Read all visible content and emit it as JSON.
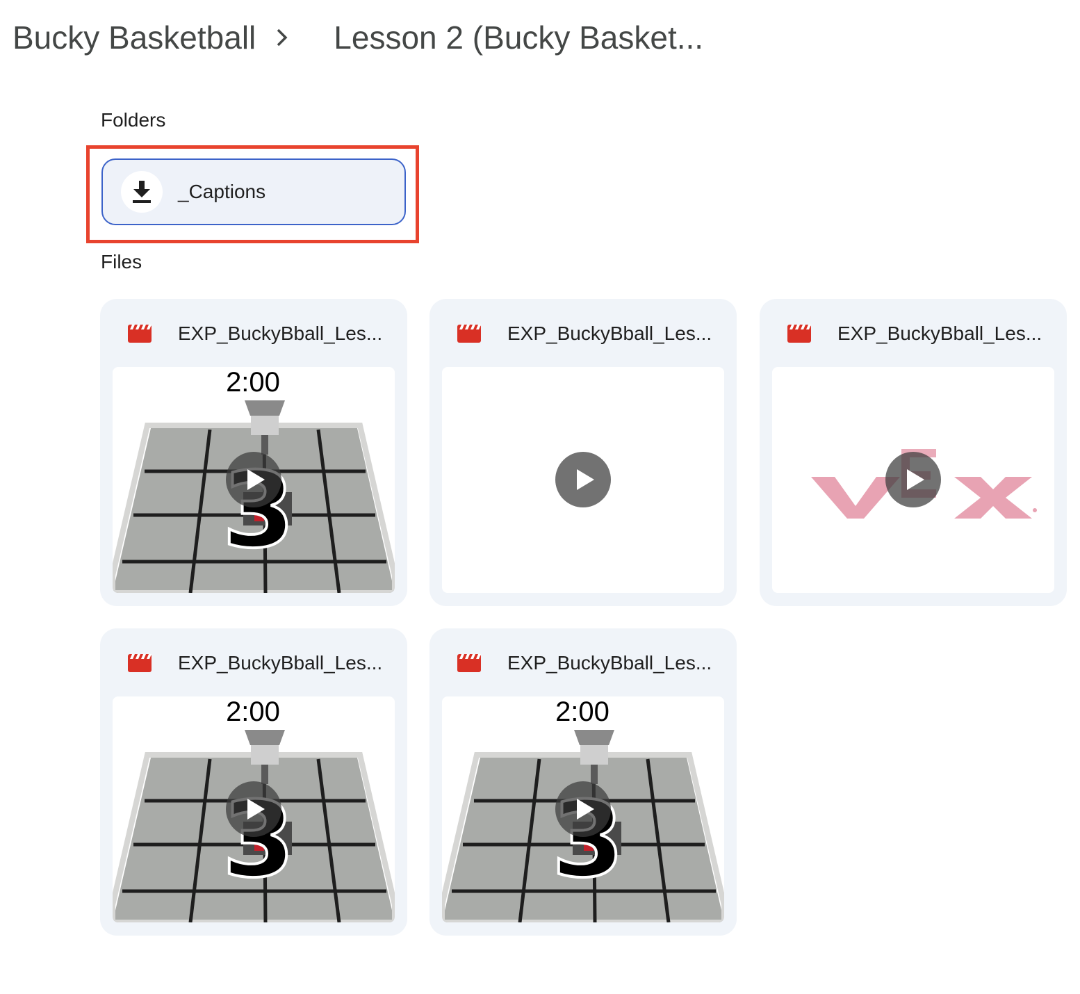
{
  "breadcrumb": {
    "root": "Bucky Basketball",
    "current": "Lesson 2 (Bucky Basket..."
  },
  "sections": {
    "folders_label": "Folders",
    "files_label": "Files"
  },
  "folders": [
    {
      "name": "_Captions",
      "icon": "download-icon"
    }
  ],
  "files": [
    {
      "name": "EXP_BuckyBball_Les...",
      "icon": "video-clapper-icon",
      "thumbnail": "field-countdown",
      "timer": "2:00"
    },
    {
      "name": "EXP_BuckyBball_Les...",
      "icon": "video-clapper-icon",
      "thumbnail": "blank",
      "timer": ""
    },
    {
      "name": "EXP_BuckyBball_Les...",
      "icon": "video-clapper-icon",
      "thumbnail": "vex-logo",
      "timer": ""
    },
    {
      "name": "EXP_BuckyBball_Les...",
      "icon": "video-clapper-icon",
      "thumbnail": "field-countdown",
      "timer": "2:00"
    },
    {
      "name": "EXP_BuckyBball_Les...",
      "icon": "video-clapper-icon",
      "thumbnail": "field-countdown",
      "timer": "2:00"
    }
  ],
  "colors": {
    "highlight": "#e8432e",
    "folder_border": "#3c63c9",
    "card_bg": "#f0f4f9",
    "video_icon": "#d93025",
    "vex_logo": "#e8a3b3"
  }
}
